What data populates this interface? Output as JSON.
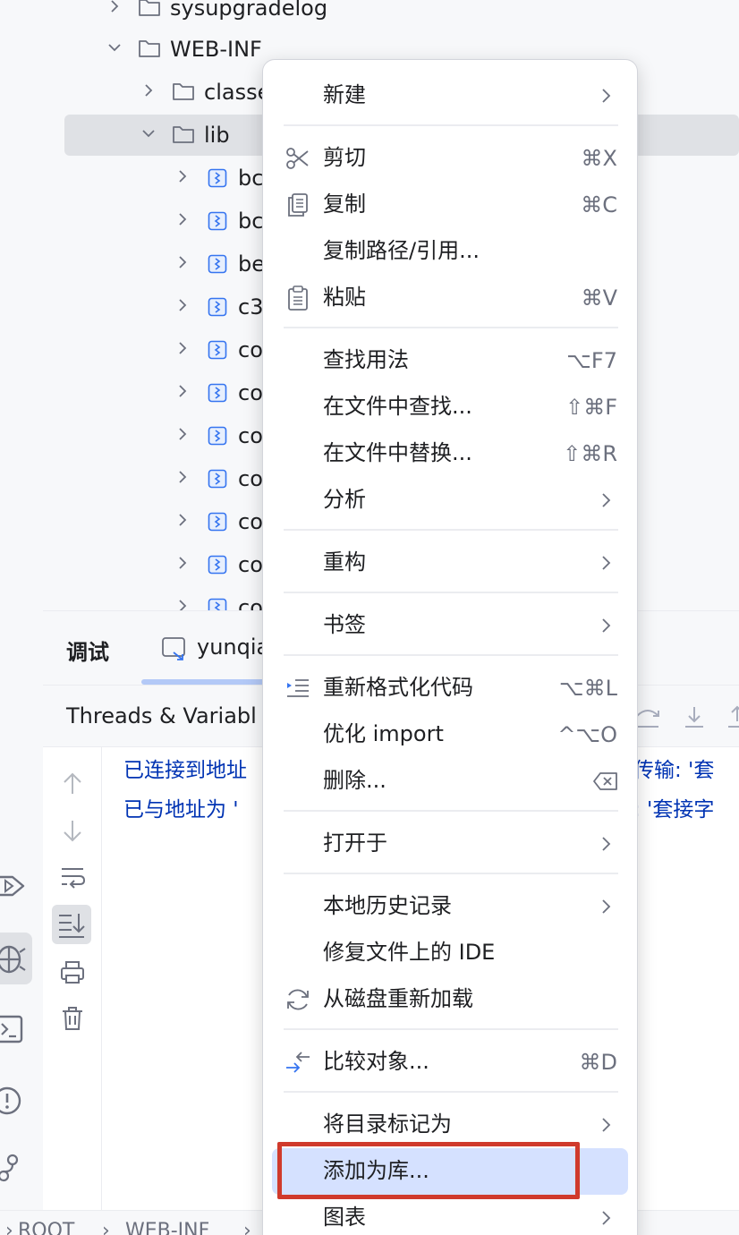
{
  "project_tree": {
    "rows": [
      {
        "label": "sysupgradelog",
        "kind": "folder",
        "expanded": false
      },
      {
        "label": "WEB-INF",
        "kind": "folder",
        "expanded": true
      },
      {
        "label": "classes",
        "kind": "folder",
        "expanded": false
      },
      {
        "label": "lib",
        "kind": "folder",
        "expanded": true,
        "selected": true
      },
      {
        "label": "bc",
        "kind": "jar"
      },
      {
        "label": "bc",
        "kind": "jar"
      },
      {
        "label": "be",
        "kind": "jar"
      },
      {
        "label": "c3",
        "kind": "jar"
      },
      {
        "label": "co",
        "kind": "jar"
      },
      {
        "label": "co",
        "kind": "jar"
      },
      {
        "label": "co",
        "kind": "jar"
      },
      {
        "label": "co",
        "kind": "jar"
      },
      {
        "label": "co",
        "kind": "jar"
      },
      {
        "label": "co",
        "kind": "jar"
      },
      {
        "label": "co",
        "kind": "jar"
      }
    ]
  },
  "debug_panel": {
    "tab_title": "调试",
    "config_tab": "yunqia",
    "threads_label": "Threads & Variabl",
    "console_lines": [
      {
        "left": "已连接到地址",
        "right": "传输: '套"
      },
      {
        "left": "已与地址为 '",
        "right": ": '套接字"
      }
    ]
  },
  "status_bar": {
    "breadcrumb": [
      "ROOT",
      "WEB-INF"
    ]
  },
  "context_menu": {
    "items": [
      {
        "label": "新建",
        "submenu": true
      },
      {
        "separator": true
      },
      {
        "label": "剪切",
        "icon": "scissors-icon",
        "shortcut": "⌘X"
      },
      {
        "label": "复制",
        "icon": "copy-icon",
        "shortcut": "⌘C"
      },
      {
        "label": "复制路径/引用..."
      },
      {
        "label": "粘贴",
        "icon": "clipboard-icon",
        "shortcut": "⌘V"
      },
      {
        "separator": true
      },
      {
        "label": "查找用法",
        "shortcut": "⌥F7"
      },
      {
        "label": "在文件中查找...",
        "shortcut": "⇧⌘F"
      },
      {
        "label": "在文件中替换...",
        "shortcut": "⇧⌘R"
      },
      {
        "label": "分析",
        "submenu": true
      },
      {
        "separator": true
      },
      {
        "label": "重构",
        "submenu": true
      },
      {
        "separator": true
      },
      {
        "label": "书签",
        "submenu": true
      },
      {
        "separator": true
      },
      {
        "label": "重新格式化代码",
        "icon": "reformat-icon",
        "shortcut": "⌥⌘L"
      },
      {
        "label": "优化 import",
        "shortcut": "^⌥O"
      },
      {
        "label": "删除...",
        "shortcut_icon": "backspace-icon"
      },
      {
        "separator": true
      },
      {
        "label": "打开于",
        "submenu": true
      },
      {
        "separator": true
      },
      {
        "label": "本地历史记录",
        "submenu": true
      },
      {
        "label": "修复文件上的 IDE"
      },
      {
        "label": "从磁盘重新加载",
        "icon": "reload-icon"
      },
      {
        "separator": true
      },
      {
        "label": "比较对象...",
        "icon": "compare-icon",
        "shortcut": "⌘D"
      },
      {
        "separator": true
      },
      {
        "label": "将目录标记为",
        "submenu": true
      },
      {
        "label": "添加为库...",
        "highlighted": true
      },
      {
        "label": "图表",
        "submenu": true
      }
    ]
  },
  "colors": {
    "accent": "#3574f0",
    "menu_highlight": "#d5e1ff",
    "annotation_box": "#d03a2c",
    "console_text": "#0033b3"
  }
}
